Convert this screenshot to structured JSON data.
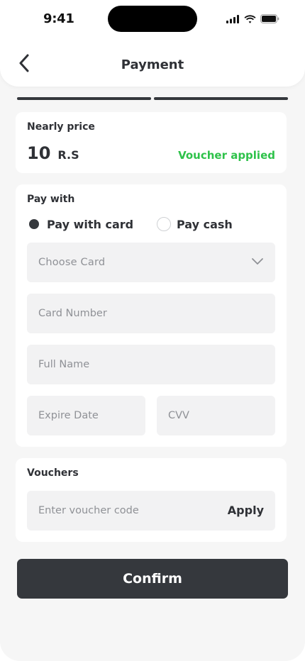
{
  "status_bar": {
    "time": "9:41",
    "icons": [
      "cellular-signal-icon",
      "wifi-icon",
      "battery-icon"
    ]
  },
  "header": {
    "title": "Payment",
    "back_icon": "chevron-left-icon"
  },
  "progress": {
    "steps_total": 2,
    "steps_completed": 2,
    "color": "#35383d"
  },
  "price_section": {
    "label": "Nearly price",
    "amount": "10",
    "currency": "R.S",
    "voucher_status": "Voucher applied",
    "voucher_status_color": "#2ec24a"
  },
  "pay_section": {
    "label": "Pay with",
    "options": [
      {
        "label": "Pay with card",
        "selected": true
      },
      {
        "label": "Pay cash",
        "selected": false
      }
    ],
    "choose_card": {
      "placeholder": "Choose Card",
      "icon": "chevron-down-icon"
    },
    "card_number": {
      "placeholder": "Card Number",
      "value": ""
    },
    "full_name": {
      "placeholder": "Full Name",
      "value": ""
    },
    "expire_date": {
      "placeholder": "Expire Date",
      "value": ""
    },
    "cvv": {
      "placeholder": "CVV",
      "value": ""
    }
  },
  "voucher_section": {
    "label": "Vouchers",
    "input": {
      "placeholder": "Enter voucher code",
      "value": ""
    },
    "apply_label": "Apply"
  },
  "confirm_label": "Confirm",
  "colors": {
    "background": "#f6f6f6",
    "card": "#ffffff",
    "field": "#f2f2f3",
    "primary": "#35383d",
    "text": "#2f3136",
    "placeholder": "#8f9196"
  }
}
